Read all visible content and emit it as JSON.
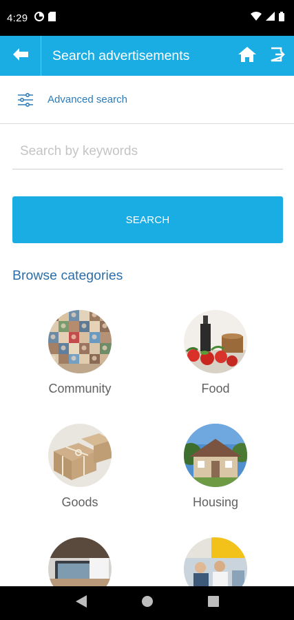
{
  "status_bar": {
    "time": "4:29",
    "icons": [
      "data-saver-icon",
      "sim-card-icon",
      "wifi-icon",
      "signal-icon",
      "battery-icon"
    ]
  },
  "app_bar": {
    "title": "Search advertisements",
    "back_icon": "arrow-left-icon",
    "home_icon": "home-icon",
    "exit_icon": "exit-icon",
    "color": "#1aade3"
  },
  "advanced_search": {
    "label": "Advanced search",
    "icon": "sliders-icon"
  },
  "search": {
    "placeholder": "Search by keywords",
    "value": "",
    "button_label": "SEARCH"
  },
  "browse": {
    "heading": "Browse categories",
    "categories": [
      {
        "label": "Community"
      },
      {
        "label": "Food"
      },
      {
        "label": "Goods"
      },
      {
        "label": "Housing"
      },
      {
        "label": ""
      },
      {
        "label": ""
      }
    ]
  },
  "nav_bar": {
    "icons": [
      "back-triangle-icon",
      "home-circle-icon",
      "recents-square-icon"
    ]
  },
  "colors": {
    "accent": "#1aade3",
    "link": "#2b7bb9",
    "heading": "#2b6ea8"
  }
}
